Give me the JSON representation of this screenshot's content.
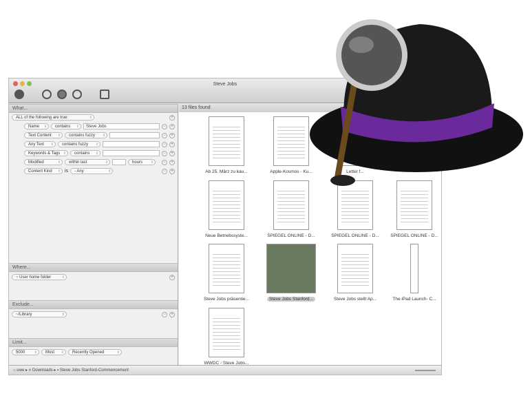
{
  "window": {
    "title": "Steve Jobs"
  },
  "what": {
    "header": "What...",
    "match": "ALL of the following are true:",
    "criteria": [
      {
        "attr": "Name",
        "op": "contains",
        "value": "Steve Jobs"
      },
      {
        "attr": "Text Content",
        "op": "contains fuzzy",
        "value": ""
      },
      {
        "attr": "Any Text",
        "op": "contains fuzzy",
        "value": ""
      },
      {
        "attr": "Keywords & Tags",
        "op": "contains",
        "value": ""
      },
      {
        "attr": "Modified",
        "op": "within last",
        "value": "",
        "unit": "hours"
      },
      {
        "attr": "Content Kind",
        "op": "is",
        "value": "- Any"
      }
    ]
  },
  "where": {
    "header": "Where...",
    "value": "~ User home folder"
  },
  "exclude": {
    "header": "Exclude...",
    "value": "~/Library"
  },
  "limit": {
    "header": "Limit...",
    "count": "5000",
    "mode": "Most",
    "sort": "Recently Opened"
  },
  "results": {
    "count": "13 files found",
    "files": [
      "Ab 25. März zu kau...",
      "Apple-Kosmos - Ku...",
      "Letter f...",
      "",
      "Neue Betriebssyste...",
      "SPIEGEL ONLINE - D...",
      "SPIEGEL ONLINE - D...",
      "SPIEGEL ONLINE - D...",
      "Steve Jobs präsentie...",
      "Steve Jobs Stanford...",
      "Steve Jobs stellt Ap...",
      "The iPad Launch- C...",
      "WWDC - Steve Jobs..."
    ]
  },
  "path": {
    "segments": [
      "uwe",
      "Downloads",
      "Steve Jobs Stanford-Commencement"
    ]
  },
  "colors": {
    "hat_band": "#6a2a9c",
    "accent": "#3a6fd0"
  }
}
